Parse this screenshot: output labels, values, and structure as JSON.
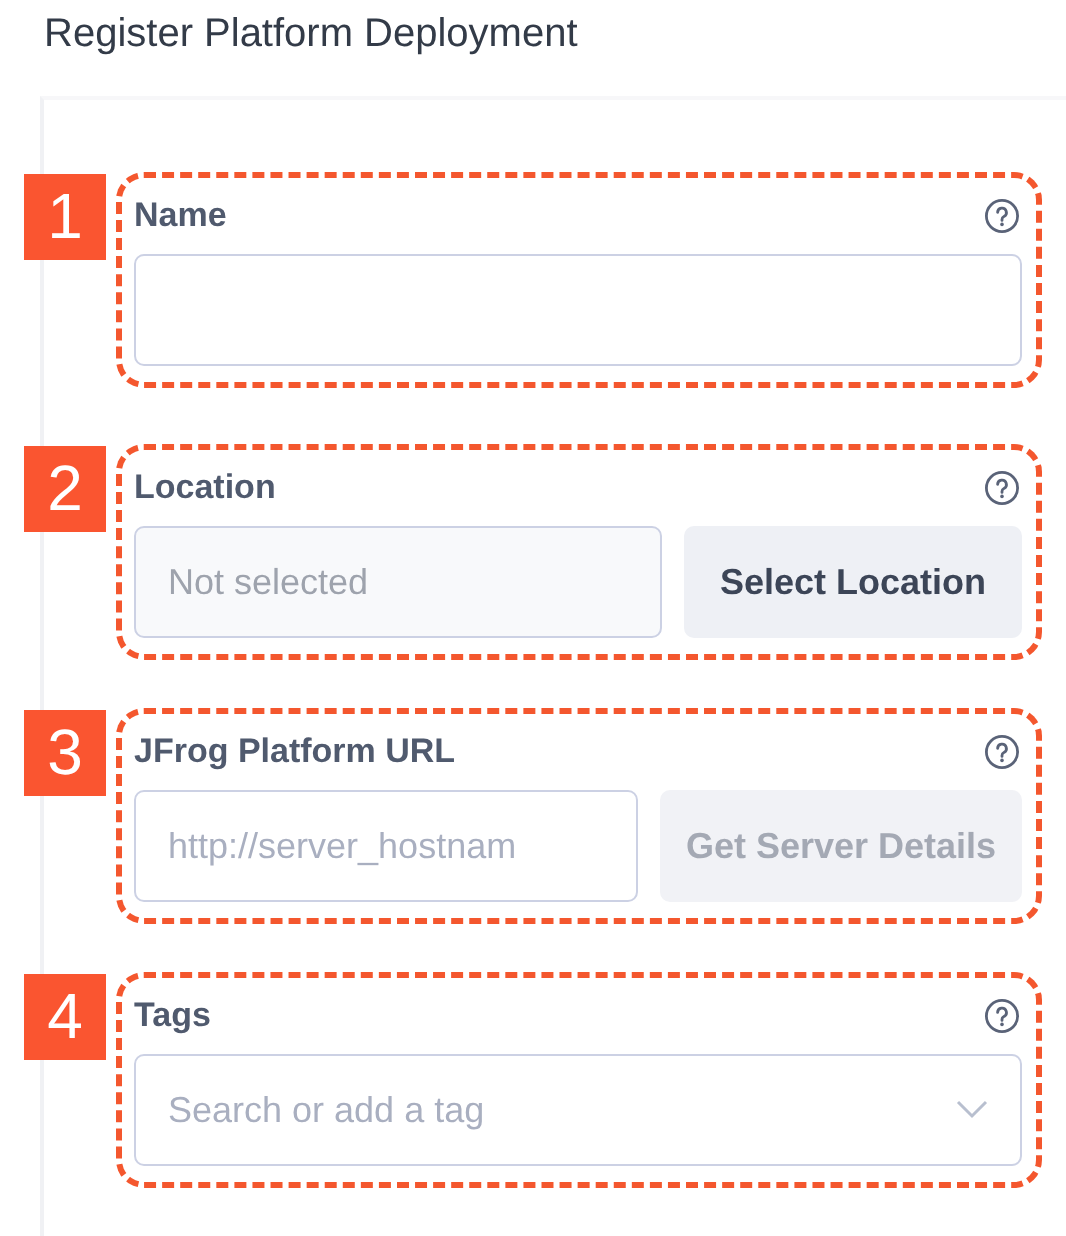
{
  "title": "Register Platform Deployment",
  "sections": [
    {
      "number": "1",
      "label": "Name",
      "kind": "text"
    },
    {
      "number": "2",
      "label": "Location",
      "kind": "picker",
      "placeholder": "Not selected",
      "button": {
        "label": "Select Location",
        "disabled": false
      }
    },
    {
      "number": "3",
      "label": "JFrog Platform URL",
      "kind": "picker-input",
      "placeholder": "http://server_hostnam",
      "button": {
        "label": "Get Server Details",
        "disabled": true
      }
    },
    {
      "number": "4",
      "label": "Tags",
      "kind": "dropdown",
      "placeholder": "Search or add a tag"
    }
  ]
}
